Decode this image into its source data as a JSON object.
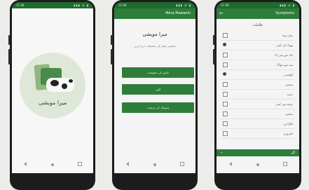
{
  "status": {
    "time": "11:08",
    "icons": "▮▮▮ ◔ ▮"
  },
  "phone1": {
    "brand_text": "میرا مویشی"
  },
  "phone2": {
    "appbar_title": "Mera Mawashi",
    "title": "میرا مویشی",
    "subtitle": "مختصر بیمار کی تفصیلات درج کریں",
    "buttons": [
      {
        "label": "جانور کی معلومات"
      },
      {
        "label": "گوبر"
      },
      {
        "label": "ہسپتال کی ترتیبات"
      }
    ]
  },
  "phone3": {
    "appbar_title": "Symptoms",
    "header": "علامات",
    "rows": [
      {
        "label": "بخار ہونا"
      },
      {
        "label": "بھوک کی کمی"
      },
      {
        "label": "ناک سے پانی آنا"
      },
      {
        "label": "منہ سے جھاگ"
      },
      {
        "label": "کھانسی"
      },
      {
        "label": "سستی"
      },
      {
        "label": "دست"
      },
      {
        "label": "دودھ میں کمی"
      },
      {
        "label": "سانس"
      },
      {
        "label": "لنگڑا پن"
      },
      {
        "label": "کمزوری"
      }
    ],
    "footer_left": "←",
    "footer_right": "آگے"
  },
  "colors": {
    "primary": "#2f7d3a",
    "status": "#1f6a2d"
  }
}
